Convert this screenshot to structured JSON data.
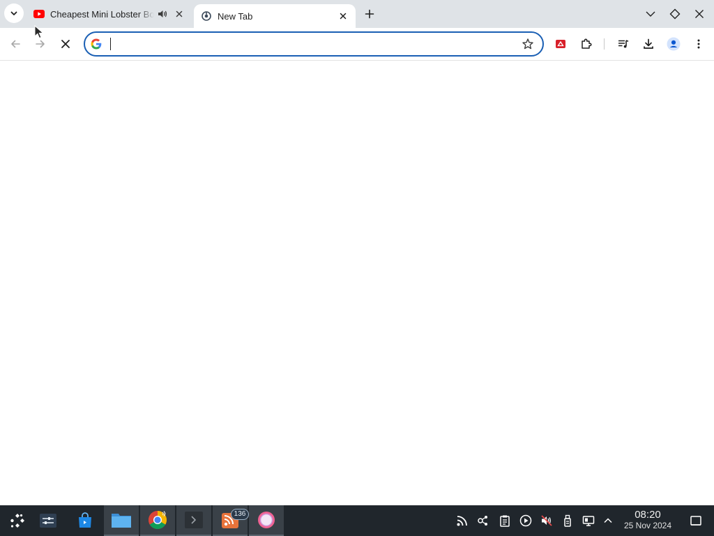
{
  "browser": {
    "tabs": [
      {
        "title": "Cheapest Mini Lobster Boat",
        "favicon": "youtube-icon",
        "audio": "speaker-icon",
        "active": false
      },
      {
        "title": "New Tab",
        "favicon": "chrome-newtab-icon",
        "active": true
      }
    ],
    "omnibox": {
      "value": "",
      "placeholder": ""
    },
    "colors": {
      "tabstrip": "#dfe3e7",
      "omnibox_border": "#1a5fb4",
      "youtube_red": "#ff0000"
    }
  },
  "taskbar": {
    "apps": [
      "launcher-icon",
      "settings-icon",
      "store-icon",
      "files-icon",
      "chrome-icon",
      "terminal-icon",
      "rss-reader-icon",
      "app-icon"
    ],
    "rss_badge": "136",
    "clock": {
      "time": "08:20",
      "date": "25 Nov 2024"
    },
    "colors": {
      "background": "#20262c"
    }
  }
}
